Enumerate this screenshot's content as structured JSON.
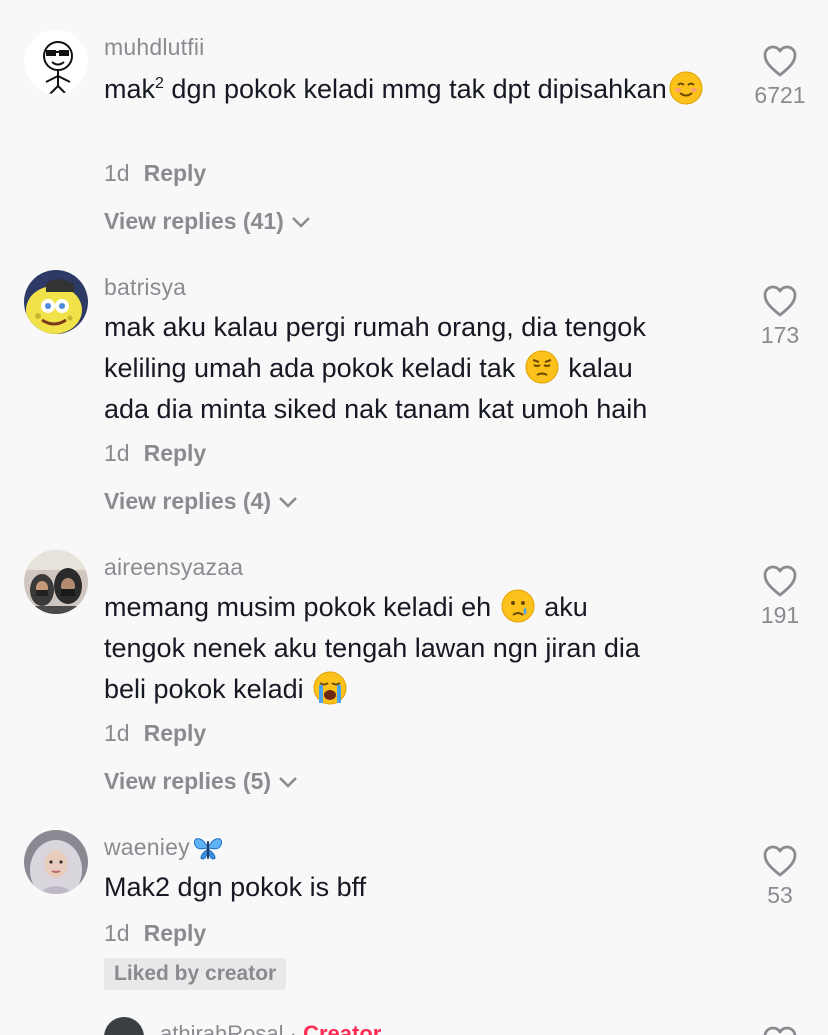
{
  "comments": [
    {
      "username": "muhdlutfii",
      "text_part1": "mak",
      "text_sup": "2",
      "text_part2": " dgn pokok keladi mmg tak dpt dipisahkan",
      "emoji": "relieved-face",
      "time": "1d",
      "reply_label": "Reply",
      "view_replies": "View replies (41)",
      "likes": "6721"
    },
    {
      "username": "batrisya",
      "text_line1": "mak aku kalau pergi rumah orang, dia tengok",
      "text_line2a": "keliling umah ada pokok keladi tak ",
      "emoji": "pensive-face",
      "text_line2b": " kalau",
      "text_line3": "ada dia minta siked nak tanam kat umoh haih",
      "time": "1d",
      "reply_label": "Reply",
      "view_replies": "View replies (4)",
      "likes": "173"
    },
    {
      "username": "aireensyazaa",
      "text_line1a": "memang musim pokok keladi eh ",
      "emoji1": "crying-face",
      "text_line1b": " aku",
      "text_line2": "tengok nenek aku tengah lawan ngn jiran dia",
      "text_line3": "beli pokok keladi ",
      "emoji2": "loudly-crying-face",
      "time": "1d",
      "reply_label": "Reply",
      "view_replies": "View replies (5)",
      "likes": "191"
    },
    {
      "username": "waeniey",
      "username_emoji": "butterfly",
      "text": "Mak2 dgn pokok is bff",
      "time": "1d",
      "reply_label": "Reply",
      "liked_by_creator": "Liked by creator",
      "likes": "53"
    }
  ],
  "partial_comment": {
    "username": "athirahRosal",
    "separator": " · ",
    "creator_label": "Creator"
  },
  "colors": {
    "background": "#f8f8f8",
    "text": "#161823",
    "muted": "#8a8b91",
    "creator": "#fe2c55"
  }
}
